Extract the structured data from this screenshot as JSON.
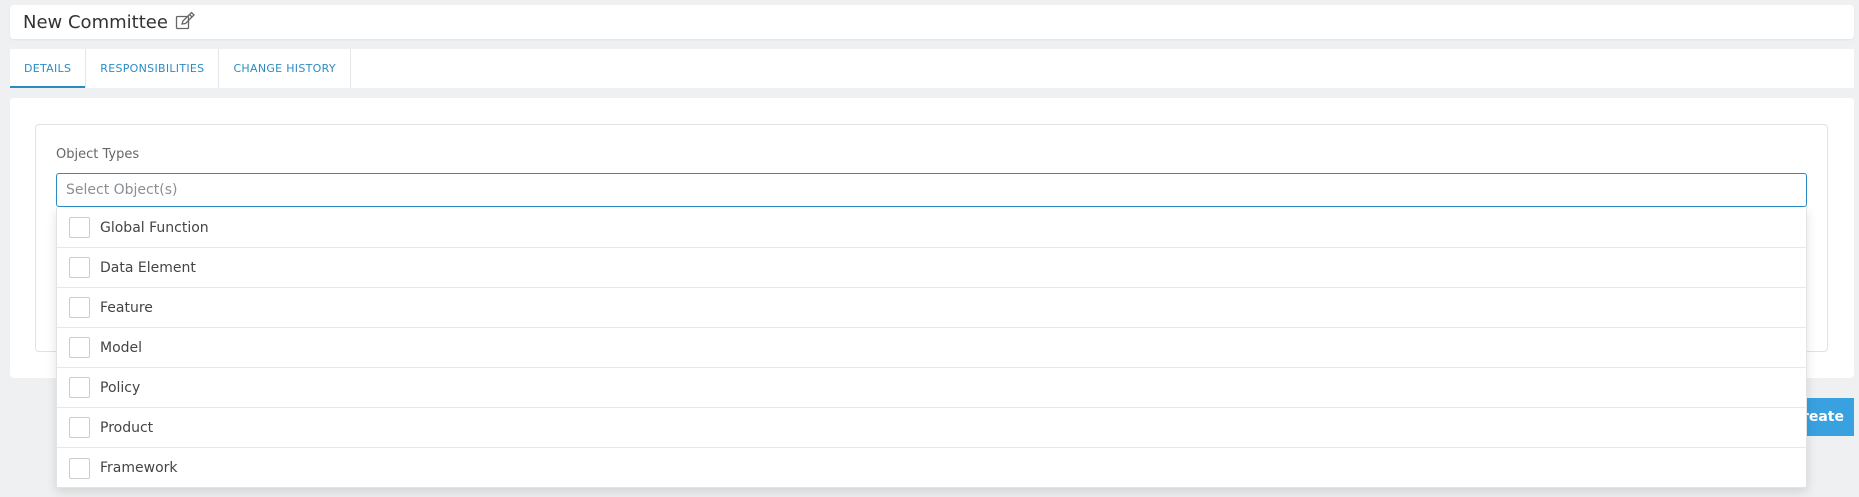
{
  "header": {
    "title": "New Committee",
    "edit_icon": "edit-icon"
  },
  "tabs": [
    {
      "label": "DETAILS",
      "active": true
    },
    {
      "label": "RESPONSIBILITIES",
      "active": false
    },
    {
      "label": "CHANGE HISTORY",
      "active": false
    }
  ],
  "form": {
    "object_types_label": "Object Types",
    "object_types_placeholder": "Select Object(s)",
    "object_types_value": "",
    "options": [
      {
        "label": "Global Function",
        "checked": false
      },
      {
        "label": "Data Element",
        "checked": false
      },
      {
        "label": "Feature",
        "checked": false
      },
      {
        "label": "Model",
        "checked": false
      },
      {
        "label": "Policy",
        "checked": false
      },
      {
        "label": "Product",
        "checked": false
      },
      {
        "label": "Framework",
        "checked": false
      }
    ]
  },
  "actions": {
    "create_label": "reate"
  },
  "colors": {
    "accent": "#2b8cc4",
    "button": "#39a1e0",
    "background": "#eef0f2"
  }
}
